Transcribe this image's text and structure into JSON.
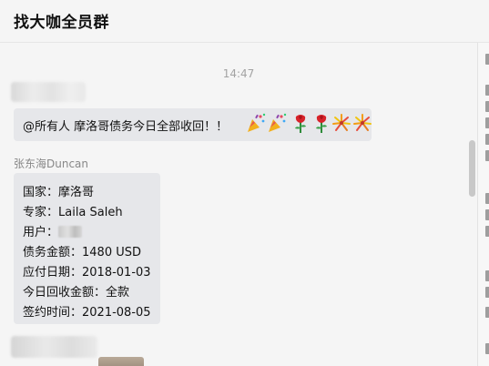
{
  "header": {
    "title": "找大咖全员群"
  },
  "chat": {
    "timestamp": "14:47",
    "message1": {
      "text": "@所有人  摩洛哥债务今日全部收回！！",
      "emojis": [
        "party-popper",
        "party-popper",
        "rose",
        "rose",
        "firework",
        "firework"
      ]
    },
    "message2": {
      "sender": "张东海Duncan",
      "lines": {
        "country": "国家：摩洛哥",
        "expert": "专家：Laila Saleh",
        "user_label": "用户：",
        "amount": "债务金额：1480 USD",
        "due_date": "应付日期：2018-01-03",
        "recovered": "今日回收金额：全款",
        "signed": "签约时间：2021-08-05"
      }
    }
  },
  "colors": {
    "bubble": "#e6e7ea",
    "background": "#f5f5f5",
    "timestamp": "#a3a3a3"
  }
}
